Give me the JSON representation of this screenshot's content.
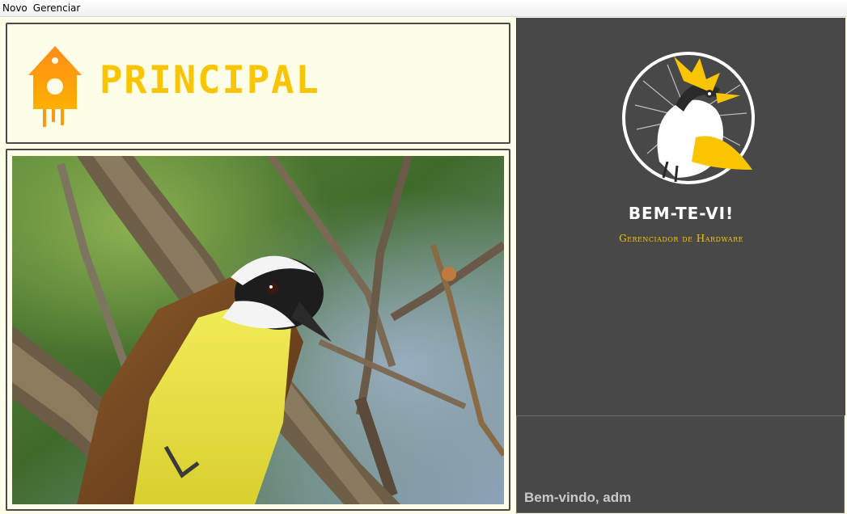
{
  "menu": {
    "items": [
      {
        "label": "Novo"
      },
      {
        "label": "Gerenciar"
      }
    ]
  },
  "header": {
    "icon": "birdhouse-icon",
    "title": "PRINCIPAL",
    "title_color": "#f8c500"
  },
  "photo": {
    "subject": "bird-photo"
  },
  "brand": {
    "logo": "bem-te-vi-logo",
    "name": "BEM-TE-VI!",
    "subtitle": "Gerenciador de Hardware",
    "accent_color": "#f8c500"
  },
  "status": {
    "welcome": "Bem-vindo, adm"
  },
  "colors": {
    "background": "#fefee8",
    "dark_panel": "#484848",
    "border": "#4a4a4a"
  }
}
